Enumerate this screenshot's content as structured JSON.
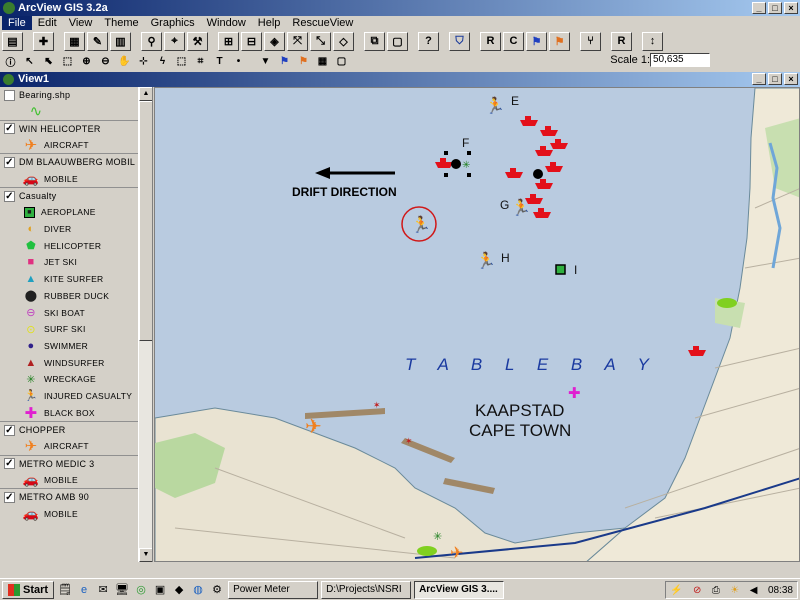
{
  "app": {
    "title": "ArcView GIS 3.2a"
  },
  "menu": [
    {
      "label": "File",
      "active": true
    },
    {
      "label": "Edit"
    },
    {
      "label": "View"
    },
    {
      "label": "Theme"
    },
    {
      "label": "Graphics"
    },
    {
      "label": "Window"
    },
    {
      "label": "Help"
    },
    {
      "label": "RescueView"
    }
  ],
  "toolbar": {
    "btn_r1": "R",
    "btn_c": "C",
    "btn_r2": "R",
    "scale_label": "Scale 1:",
    "scale_value": "50,635"
  },
  "view": {
    "title": "View1"
  },
  "legend": {
    "bearing": "Bearing.shp",
    "win_helicopter": "WIN HELICOPTER",
    "aircraft": "AIRCRAFT",
    "blaauwberg": "DM BLAAUWBERG MOBIL",
    "mobile": "MOBILE",
    "casualty": "Casualty",
    "casualty_items": [
      "AEROPLANE",
      "DIVER",
      "HELICOPTER",
      "JET SKI",
      "KITE SURFER",
      "RUBBER DUCK",
      "SKI BOAT",
      "SURF SKI",
      "SWIMMER",
      "WINDSURFER",
      "WRECKAGE",
      "INJURED CASUALTY",
      "BLACK BOX"
    ],
    "chopper": "CHOPPER",
    "chopper_item": "AIRCRAFT",
    "metro_medic": "METRO MEDIC 3",
    "metro_medic_item": "MOBILE",
    "metro_amb": "METRO AMB 90",
    "metro_amb_item": "MOBILE"
  },
  "map": {
    "drift_label": "DRIFT DIRECTION",
    "bay_label": "T A B L E   B A Y",
    "city_af": "KAAPSTAD",
    "city_en": "CAPE TOWN",
    "markers": {
      "e": "E",
      "f": "F",
      "g": "G",
      "h": "H",
      "i": "I"
    }
  },
  "taskbar": {
    "start": "Start",
    "tasks": [
      "Power Meter",
      "D:\\Projects\\NSRI",
      "ArcView GIS 3...."
    ],
    "clock": "08:38"
  },
  "colors": {
    "title_bar": "#0a246a",
    "water": "#b9cbe0",
    "boat_red": "#e3101a",
    "casualty_red": "#b01818",
    "cross_magenta": "#e020d0"
  }
}
